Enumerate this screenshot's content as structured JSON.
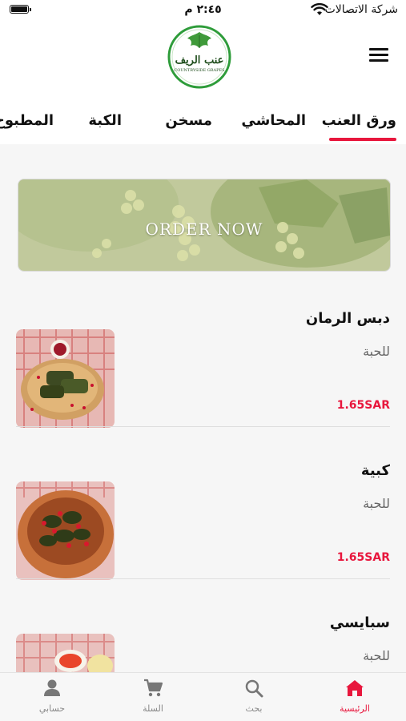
{
  "status_bar": {
    "time": "٢:٤٥ م",
    "carrier": "شركة الاتصالات"
  },
  "header": {
    "logo_text_ar": "عنب الريف",
    "logo_text_en": "COUNTRYSIDE GRAPES"
  },
  "tabs": [
    {
      "label": "ورق العنب",
      "active": true
    },
    {
      "label": "المحاشي",
      "active": false
    },
    {
      "label": "مسخن",
      "active": false
    },
    {
      "label": "الكبة",
      "active": false
    },
    {
      "label": "المطبوخ",
      "active": false
    }
  ],
  "banner": {
    "label": "ORDER NOW"
  },
  "products": [
    {
      "name": "دبس الرمان",
      "unit": "للحبة",
      "price": "1.65SAR"
    },
    {
      "name": "كبية",
      "unit": "للحبة",
      "price": "1.65SAR"
    },
    {
      "name": "سبايسي",
      "unit": "للحبة",
      "price": ""
    }
  ],
  "bottom_nav": [
    {
      "label": "الرئيسية",
      "icon": "home-icon",
      "active": true
    },
    {
      "label": "بحث",
      "icon": "search-icon",
      "active": false
    },
    {
      "label": "السلة",
      "icon": "cart-icon",
      "active": false
    },
    {
      "label": "حسابي",
      "icon": "user-icon",
      "active": false
    }
  ],
  "colors": {
    "accent": "#e8173d",
    "muted_text": "#666666",
    "content_background": "#f6f6f6"
  }
}
